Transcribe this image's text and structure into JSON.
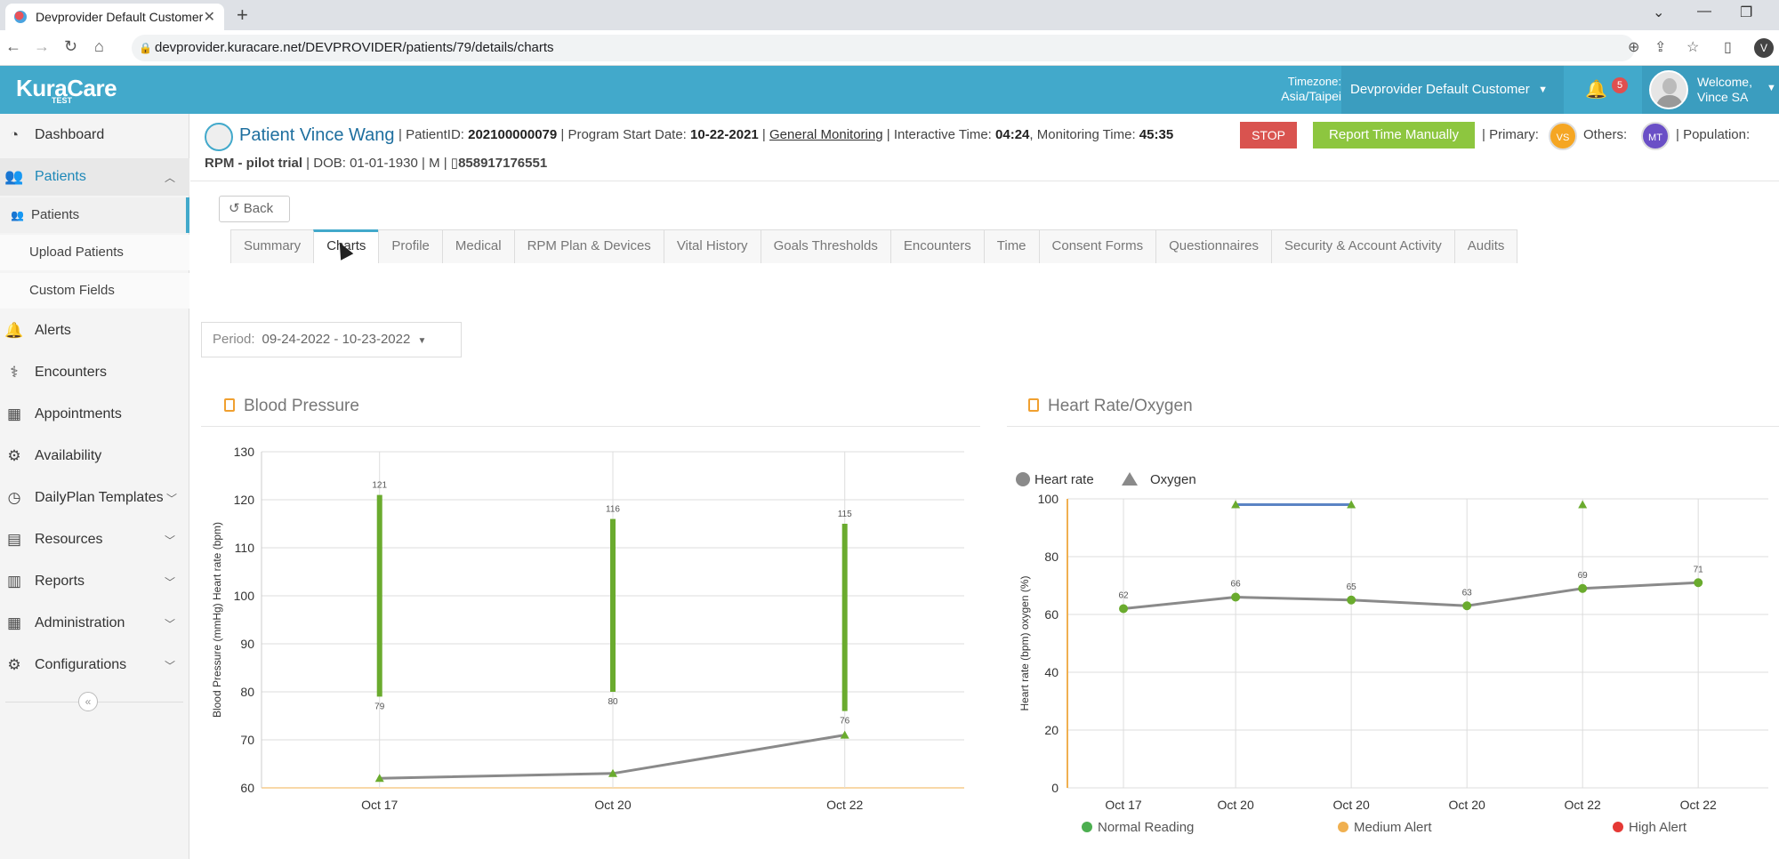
{
  "browser": {
    "tab_title": "Devprovider Default Customer",
    "url": "devprovider.kuracare.net/DEVPROVIDER/patients/79/details/charts",
    "profile_initial": "V"
  },
  "header": {
    "logo": "KuraCare",
    "logo_sub": "TEST",
    "timezone_label": "Timezone:",
    "timezone_value": "Asia/Taipei",
    "customer": "Devprovider Default Customer",
    "notification_count": "5",
    "welcome": "Welcome,",
    "user": "Vince SA"
  },
  "sidebar": {
    "items": [
      {
        "label": "Dashboard",
        "icon": "dashboard-icon"
      },
      {
        "label": "Patients",
        "icon": "users-icon"
      },
      {
        "label": "Alerts",
        "icon": "bell-icon"
      },
      {
        "label": "Encounters",
        "icon": "stethoscope-icon"
      },
      {
        "label": "Appointments",
        "icon": "calendar-icon"
      },
      {
        "label": "Availability",
        "icon": "gear-icon"
      },
      {
        "label": "DailyPlan Templates",
        "icon": "clock-icon"
      },
      {
        "label": "Resources",
        "icon": "book-icon"
      },
      {
        "label": "Reports",
        "icon": "file-icon"
      },
      {
        "label": "Administration",
        "icon": "building-icon"
      },
      {
        "label": "Configurations",
        "icon": "cog-icon"
      }
    ],
    "sub_items": [
      "Patients",
      "Upload Patients",
      "Custom Fields"
    ]
  },
  "patient": {
    "name": "Patient Vince Wang",
    "id_label": "PatientID:",
    "id": "202100000079",
    "start_label": "Program Start Date:",
    "start": "10-22-2021",
    "program": "General Monitoring",
    "interactive_label": "Interactive Time:",
    "interactive": "04:24",
    "monitoring_label": "Monitoring Time:",
    "monitoring": "45:35",
    "stop": "STOP",
    "report": "Report Time Manually",
    "primary_label": "Primary:",
    "primary": "VS",
    "others_label": "Others:",
    "others": "MT",
    "population_label": "Population:",
    "population": "RPM - pilot trial",
    "dob_label": "DOB:",
    "dob": "01-01-1930",
    "sex": "M",
    "phone": "858917176551"
  },
  "nav": {
    "back": "Back",
    "tabs": [
      "Summary",
      "Charts",
      "Profile",
      "Medical",
      "RPM Plan & Devices",
      "Vital History",
      "Goals Thresholds",
      "Encounters",
      "Time",
      "Consent Forms",
      "Questionnaires",
      "Security & Account Activity",
      "Audits"
    ]
  },
  "period": {
    "label": "Period:",
    "value": "09-24-2022 - 10-23-2022"
  },
  "panels": {
    "bp_title": "Blood Pressure",
    "hr_title": "Heart Rate/Oxygen"
  },
  "chart_data": [
    {
      "type": "bar",
      "title": "Blood Pressure",
      "ylabel": "Blood Pressure (mmHg) Heart rate (bpm)",
      "ylim": [
        60,
        130
      ],
      "yticks": [
        60,
        70,
        80,
        90,
        100,
        110,
        120,
        130
      ],
      "categories": [
        "Oct 17",
        "Oct 20",
        "Oct 22"
      ],
      "series": [
        {
          "systolic": [
            121,
            116,
            115
          ],
          "diastolic": [
            79,
            80,
            76
          ]
        },
        {
          "values": [
            62,
            63,
            71
          ]
        }
      ],
      "colors": {
        "range": "#6aab2e",
        "line": "#8a8a8a",
        "marker": "#6aab2e"
      }
    },
    {
      "type": "line",
      "title": "Heart Rate/Oxygen",
      "ylabel": "Heart rate (bpm) oxygen (%)",
      "ylim": [
        0,
        100
      ],
      "yticks": [
        0,
        20,
        40,
        60,
        80,
        100
      ],
      "categories": [
        "Oct 17",
        "Oct 20",
        "Oct 20",
        "Oct 20",
        "Oct 22",
        "Oct 22"
      ],
      "series": [
        {
          "name": "Heart rate",
          "values": [
            62,
            66,
            65,
            63,
            69,
            71
          ]
        },
        {
          "name": "Oxygen",
          "values": [
            null,
            98,
            98,
            null,
            98,
            null
          ]
        }
      ],
      "status_legend": [
        {
          "label": "Normal Reading",
          "color": "#4caf50"
        },
        {
          "label": "Medium Alert",
          "color": "#f0b050"
        },
        {
          "label": "High Alert",
          "color": "#e53935"
        }
      ],
      "colors": {
        "hr_line": "#8a8a8a",
        "hr_point": "#6aab2e",
        "oxygen": "#5b84c4",
        "axis": "#f0b050"
      }
    }
  ]
}
